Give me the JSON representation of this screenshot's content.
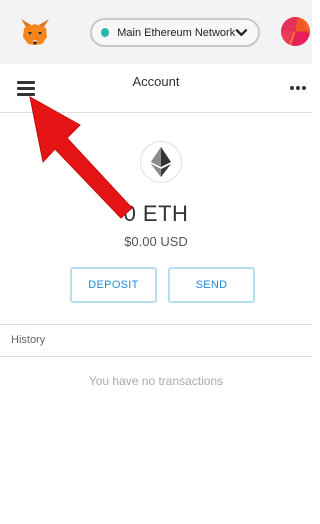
{
  "network": {
    "name": "Main Ethereum Network"
  },
  "header": {
    "title": "Account"
  },
  "balance": {
    "eth": "0 ETH",
    "fiat": "$0.00 USD"
  },
  "actions": {
    "deposit": "DEPOSIT",
    "send": "SEND"
  },
  "history": {
    "label": "History",
    "empty_message": "You have no transactions"
  },
  "colors": {
    "network_dot": "#29b6af",
    "button_text": "#1d8cd6",
    "button_border": "#b7dff2",
    "annotation_arrow": "#e61515"
  },
  "icons": {
    "logo": "fox-logo-icon",
    "menu": "hamburger-icon",
    "more": "more-dots-icon",
    "chevron": "chevron-down-icon",
    "currency": "ethereum-icon"
  }
}
